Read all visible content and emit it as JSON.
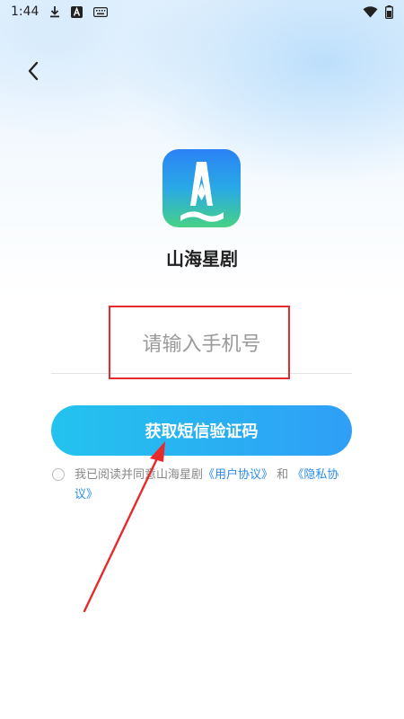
{
  "status_bar": {
    "time": "1:44",
    "icons": [
      "download-icon",
      "a-badge-icon",
      "keyboard-icon",
      "wifi-icon",
      "battery-icon"
    ]
  },
  "nav": {
    "back_icon": "chevron-left-icon"
  },
  "app": {
    "name": "山海星剧",
    "logo_colors": [
      "#2a82f5",
      "#47d186"
    ]
  },
  "login": {
    "phone_placeholder": "请输入手机号",
    "sms_button_label": "获取短信验证码",
    "agreement": {
      "prefix": "我已阅读并同意山海星剧",
      "user_agreement": "《用户协议》",
      "conjunction": "和",
      "privacy_policy": "《隐私协议》",
      "checked": false
    }
  },
  "colors": {
    "accent": "#2a8cf0",
    "button_start": "#23c3ee",
    "button_end": "#2f9ff6",
    "annotation": "#e52b2b"
  }
}
